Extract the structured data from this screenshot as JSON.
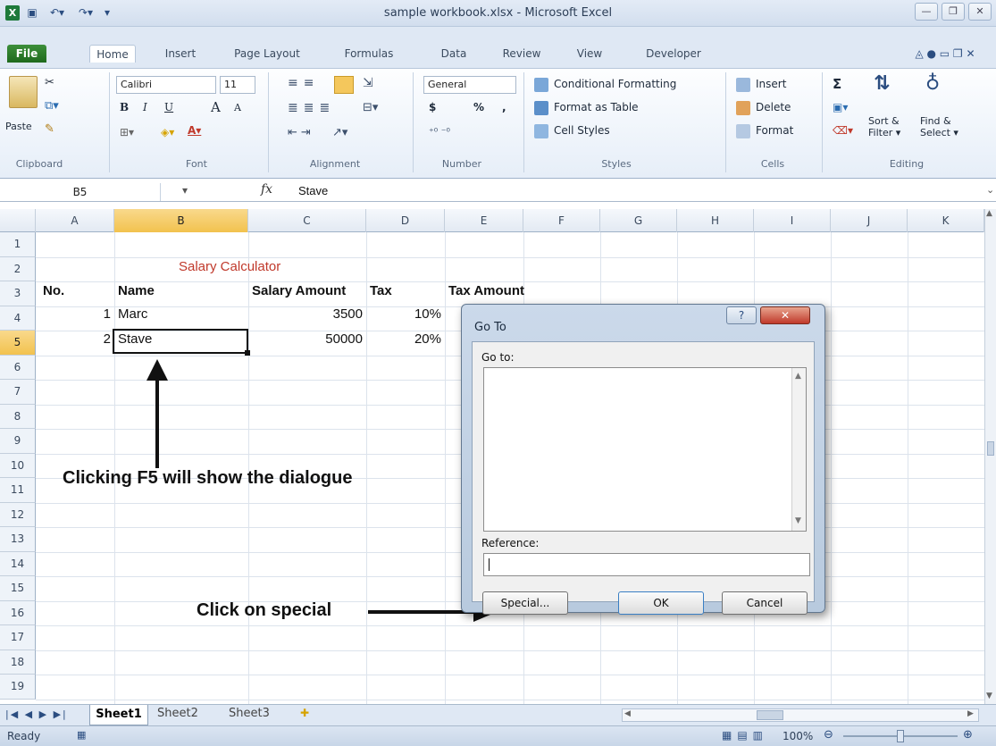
{
  "window": {
    "title": "sample workbook.xlsx - Microsoft Excel"
  },
  "quick_access": {
    "save_icon": "save-icon",
    "undo_icon": "undo-icon",
    "redo_icon": "redo-icon"
  },
  "tabs": [
    "File",
    "Home",
    "Insert",
    "Page Layout",
    "Formulas",
    "Data",
    "Review",
    "View",
    "Developer"
  ],
  "ribbon": {
    "clipboard": {
      "paste_label": "Paste",
      "group_label": "Clipboard"
    },
    "font": {
      "font_name": "Calibri",
      "font_size": "11",
      "group_label": "Font",
      "bold": "B",
      "italic": "I",
      "underline": "U",
      "grow": "A",
      "shrink": "A"
    },
    "alignment": {
      "group_label": "Alignment"
    },
    "number": {
      "format": "General",
      "currency": "$",
      "percent": "%",
      "comma": ",",
      "group_label": "Number"
    },
    "styles": {
      "conditional": "Conditional Formatting",
      "format_table": "Format as Table",
      "cell_styles": "Cell Styles",
      "group_label": "Styles"
    },
    "cells": {
      "insert": "Insert",
      "delete": "Delete",
      "format": "Format",
      "group_label": "Cells"
    },
    "editing": {
      "sum": "Σ",
      "sort_1": "Sort &",
      "sort_2": "Filter",
      "find_1": "Find &",
      "find_2": "Select",
      "group_label": "Editing"
    }
  },
  "formula_bar": {
    "name_box": "B5",
    "fx": "fx",
    "value": "Stave"
  },
  "columns": [
    "A",
    "B",
    "C",
    "D",
    "E",
    "F",
    "G",
    "H",
    "I",
    "J",
    "K"
  ],
  "rows": [
    "1",
    "2",
    "3",
    "4",
    "5",
    "6",
    "7",
    "8",
    "9",
    "10",
    "11",
    "12",
    "13",
    "14",
    "15",
    "16",
    "17",
    "18",
    "19"
  ],
  "cells": {
    "title": "Salary Calculator",
    "headers": {
      "no": "No.",
      "name": "Name",
      "salary": "Salary Amount",
      "tax": "Tax",
      "tax_amount": "Tax Amount"
    },
    "row4": {
      "no": "1",
      "name": "Marc",
      "salary": "3500",
      "tax": "10%"
    },
    "row5": {
      "no": "2",
      "name": "Stave",
      "salary": "50000",
      "tax": "20%"
    }
  },
  "annotations": {
    "f5": "Clicking F5 will show the dialogue",
    "special": "Click on special"
  },
  "dialog": {
    "title": "Go To",
    "help": "?",
    "close": "✕",
    "goto_label": "Go to:",
    "reference_label": "Reference:",
    "reference_value": "",
    "special_button": "Special...",
    "ok_button": "OK",
    "cancel_button": "Cancel"
  },
  "sheet_tabs": [
    "Sheet1",
    "Sheet2",
    "Sheet3"
  ],
  "status": {
    "mode": "Ready",
    "zoom": "100%"
  },
  "colors": {
    "accent": "#f2c24e",
    "title_text": "#c0392b",
    "file_tab": "#2e7d2b"
  }
}
